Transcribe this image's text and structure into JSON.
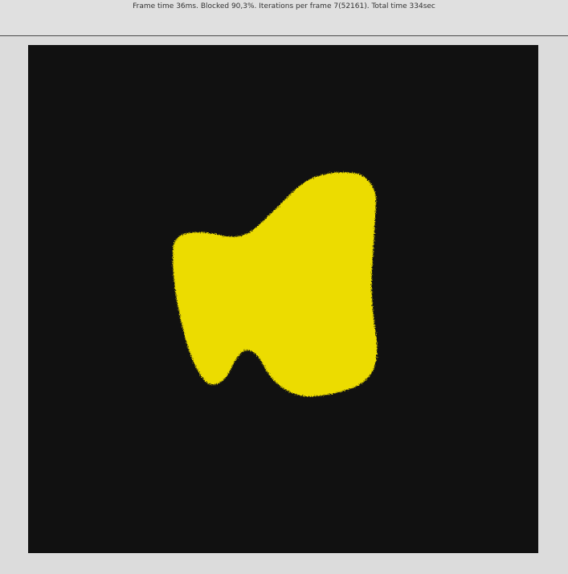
{
  "status": {
    "text": "Frame time 36ms. Blocked 90,3%. Iterations per frame 7(52161). Total time 334sec"
  },
  "canvas": {
    "background": "#111111",
    "blob_color": "#ecdc00"
  }
}
